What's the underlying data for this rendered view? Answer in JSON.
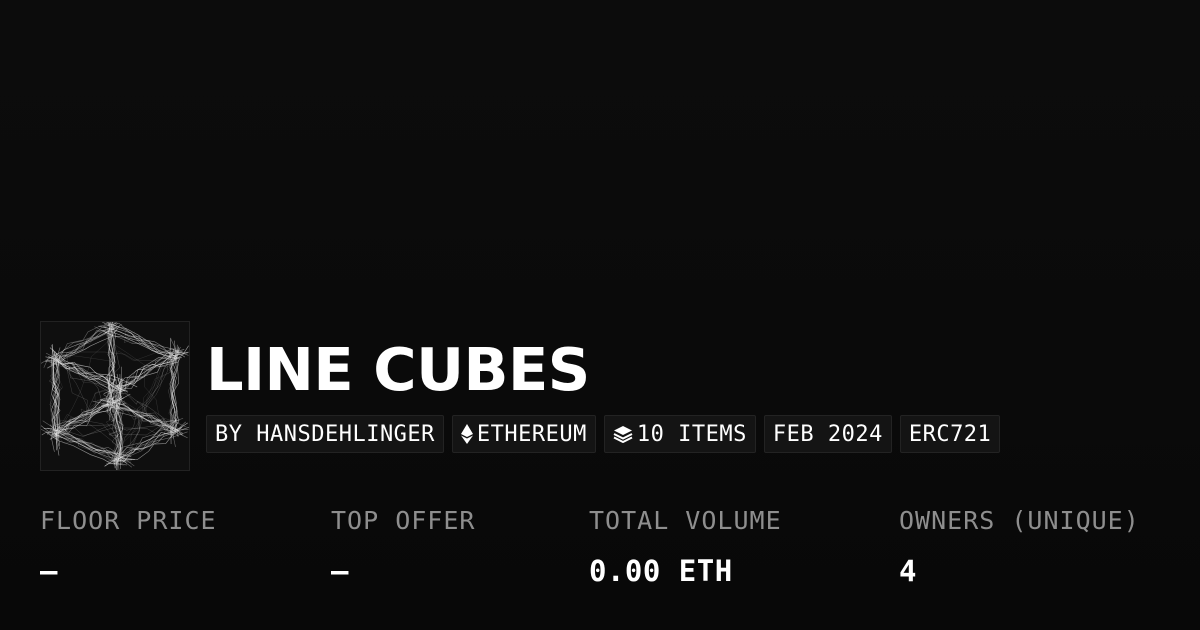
{
  "collection": {
    "title": "LINE CUBES",
    "thumbnail_icon": "line-cube-artwork"
  },
  "tags": {
    "creator": "BY HANSDEHLINGER",
    "chain": "ETHEREUM",
    "chain_icon": "ethereum-icon",
    "items": "10 ITEMS",
    "items_icon": "layers-icon",
    "date": "FEB 2024",
    "standard": "ERC721"
  },
  "stats": [
    {
      "label": "FLOOR PRICE",
      "value": "–"
    },
    {
      "label": "TOP OFFER",
      "value": "–"
    },
    {
      "label": "TOTAL VOLUME",
      "value": "0.00 ETH"
    },
    {
      "label": "OWNERS (UNIQUE)",
      "value": "4"
    }
  ],
  "colors": {
    "background": "#0a0a0a",
    "text": "#ffffff",
    "muted": "#8e8e8e",
    "tag_bg": "#141414",
    "tag_border": "#232323"
  }
}
